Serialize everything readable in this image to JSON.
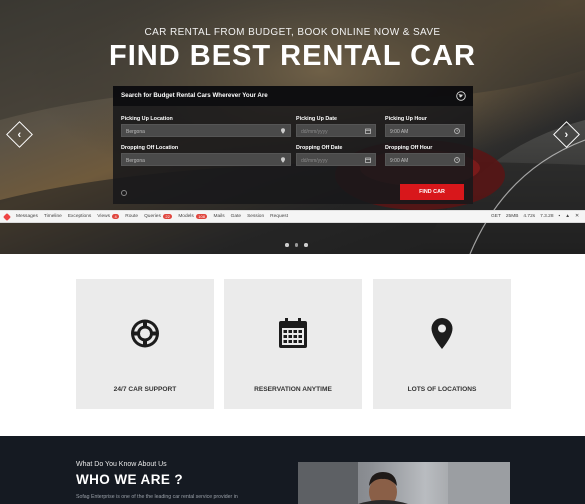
{
  "hero": {
    "subtitle": "CAR RENTAL FROM BUDGET, BOOK ONLINE NOW & SAVE",
    "title": "FIND BEST RENTAL CAR",
    "prev_arrow": "‹",
    "next_arrow": "›"
  },
  "search_form": {
    "heading": "Search for Budget Rental Cars Wherever Your Are",
    "pickup_location_label": "Picking Up Location",
    "pickup_location_value": "Bergona",
    "pickup_date_label": "Picking Up Date",
    "pickup_date_placeholder": "dd/mm/yyyy",
    "pickup_hour_label": "Picking Up Hour",
    "pickup_hour_value": "9:00 AM",
    "dropoff_location_label": "Dropping Off Location",
    "dropoff_location_value": "Bergona",
    "dropoff_date_label": "Dropping Off Date",
    "dropoff_date_placeholder": "dd/mm/yyyy",
    "dropoff_hour_label": "Dropping Off Hour",
    "dropoff_hour_value": "9:00 AM",
    "submit_label": "FIND CAR"
  },
  "debugbar": {
    "tabs": [
      {
        "label": "Messages",
        "badge": ""
      },
      {
        "label": "Timeline",
        "badge": ""
      },
      {
        "label": "Exceptions",
        "badge": ""
      },
      {
        "label": "Views",
        "badge": "4"
      },
      {
        "label": "Route",
        "badge": ""
      },
      {
        "label": "Queries",
        "badge": "22"
      },
      {
        "label": "Models",
        "badge": "108"
      },
      {
        "label": "Mails",
        "badge": ""
      },
      {
        "label": "Gate",
        "badge": ""
      },
      {
        "label": "Session",
        "badge": ""
      },
      {
        "label": "Request",
        "badge": ""
      }
    ],
    "method": "GET",
    "memory": "25MB",
    "time": "4.72s",
    "php_version": "7.3.28"
  },
  "carousel": {
    "dots": 3,
    "active_index": 1
  },
  "features": [
    {
      "label": "24/7 CAR SUPPORT",
      "icon": "lifebuoy-icon"
    },
    {
      "label": "RESERVATION ANYTIME",
      "icon": "calendar-icon"
    },
    {
      "label": "LOTS OF LOCATIONS",
      "icon": "map-pin-icon"
    }
  ],
  "about": {
    "kicker": "What Do You Know About Us",
    "title": "WHO WE ARE ?",
    "text": "Sofag Enterprise is one of the the leading car rental service provider in"
  },
  "colors": {
    "accent": "#d8171b",
    "dark_section": "#151a22",
    "card_bg": "#ebebeb"
  }
}
